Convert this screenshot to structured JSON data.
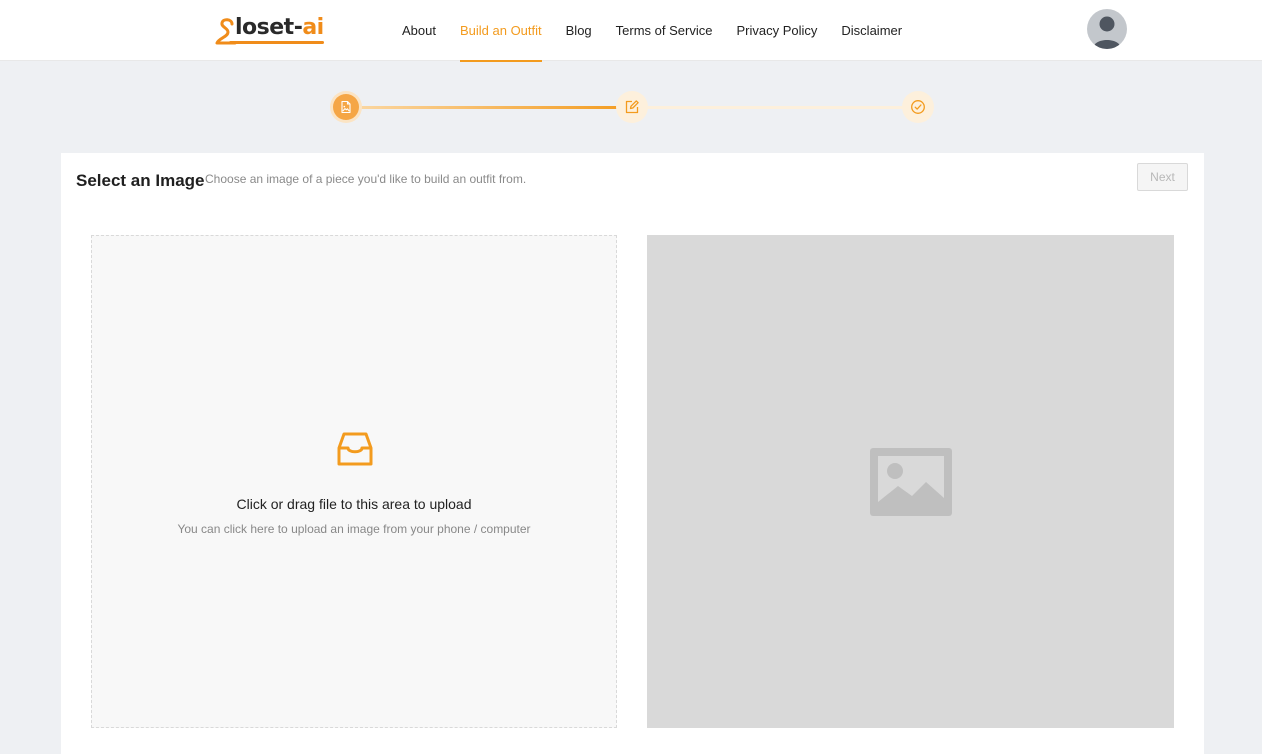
{
  "header": {
    "logo": {
      "text_main": "loset-",
      "text_accent": "ai",
      "accent_color": "#f08c1a"
    },
    "nav": [
      {
        "label": "About",
        "active": false
      },
      {
        "label": "Build an Outfit",
        "active": true
      },
      {
        "label": "Blog",
        "active": false
      },
      {
        "label": "Terms of Service",
        "active": false
      },
      {
        "label": "Privacy Policy",
        "active": false
      },
      {
        "label": "Disclaimer",
        "active": false
      }
    ],
    "avatar_icon": "user-avatar-icon"
  },
  "stepper": {
    "current_step": 1,
    "steps": [
      {
        "icon": "file-image-icon",
        "status": "current"
      },
      {
        "icon": "edit-icon",
        "status": "pending"
      },
      {
        "icon": "check-circle-icon",
        "status": "pending"
      }
    ],
    "accent_color": "#f39b1e"
  },
  "main": {
    "title": "Select an Image",
    "subtitle": "Choose an image of a piece you'd like to build an outfit from.",
    "next_label": "Next",
    "upload": {
      "icon": "inbox-icon",
      "text": "Click or drag file to this area to upload",
      "hint": "You can click here to upload an image from your phone / computer"
    },
    "preview": {
      "icon": "image-placeholder-icon"
    }
  }
}
